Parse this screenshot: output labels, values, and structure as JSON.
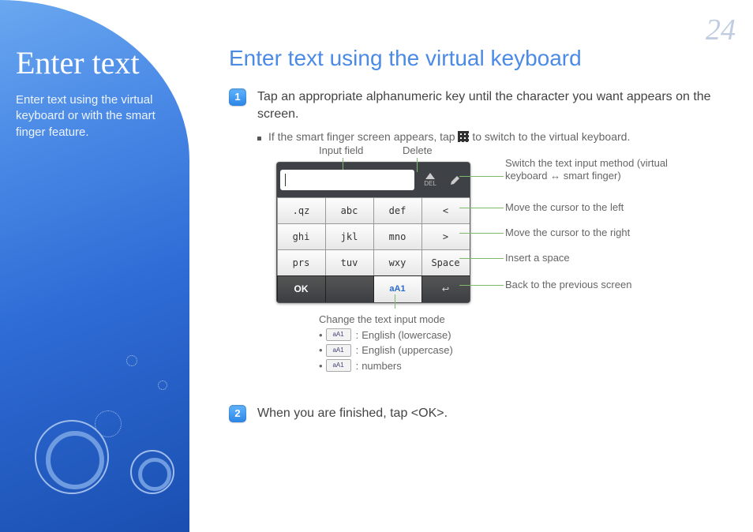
{
  "page_number": "24",
  "sidebar": {
    "title": "Enter text",
    "subtitle": "Enter text using the virtual keyboard or with the smart finger feature."
  },
  "heading": "Enter text using the virtual keyboard",
  "step1": {
    "num": "1",
    "text": "Tap an appropriate alphanumeric key until the character you want appears on the screen.",
    "sub_a": "If the smart finger screen appears, tap ",
    "sub_b": " to switch to the virtual keyboard."
  },
  "step2": {
    "num": "2",
    "text": "When you are finished, tap <OK>."
  },
  "labels": {
    "input_field": "Input field",
    "delete": "Delete",
    "switch": "Switch the text input method (virtual keyboard ↔ smart finger)",
    "cursor_left": "Move the cursor to the left",
    "cursor_right": "Move the cursor to the right",
    "space": "Insert a space",
    "back": "Back to the previous screen",
    "mode_header": "Change the text input mode",
    "mode_lower": "English (lowercase)",
    "mode_upper": "English (uppercase)",
    "mode_num": "numbers"
  },
  "keyboard": {
    "del": "DEL",
    "rows": [
      ".qz",
      "abc",
      "def",
      "<",
      "ghi",
      "jkl",
      "mno",
      ">",
      "prs",
      "tuv",
      "wxy",
      "Space"
    ],
    "ok": "OK",
    "mode": "aA1",
    "back": "↩"
  }
}
